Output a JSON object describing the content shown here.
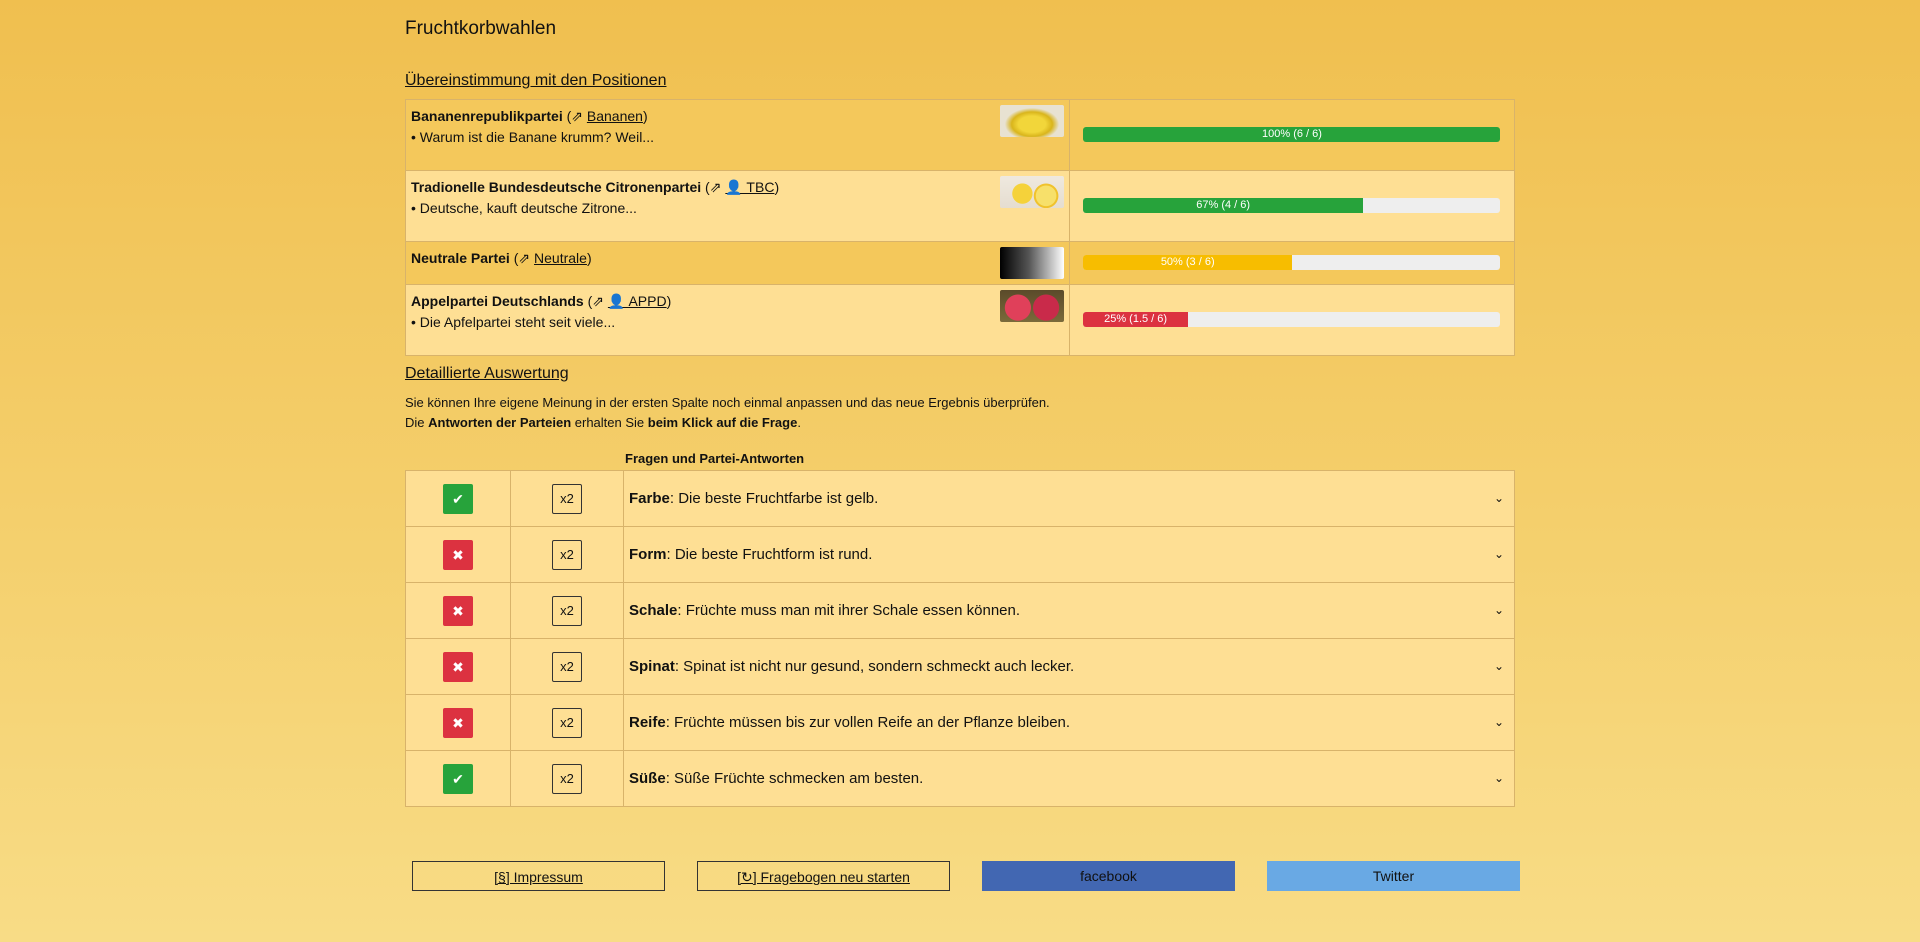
{
  "title": "Fruchtkorbwahlen",
  "sections": {
    "positions": "Übereinstimmung mit den Positionen",
    "details": "Detaillierte Auswertung"
  },
  "parties": [
    {
      "name": "Bananenrepublikpartei",
      "link": "Bananen",
      "desc": "• Warum ist die Banane krumm? Weil...",
      "bar_label": "100% (6 / 6)",
      "percent": 100,
      "color": "#27a33b",
      "icon": "banana-image"
    },
    {
      "name": "Tradionelle Bundesdeutsche Citronenpartei",
      "link": "👤 TBC",
      "desc": "• Deutsche, kauft deutsche Zitrone...",
      "bar_label": "67% (4 / 6)",
      "percent": 67,
      "color": "#27a33b",
      "icon": "lemon-image"
    },
    {
      "name": "Neutrale Partei",
      "link": "Neutrale",
      "desc": "",
      "bar_label": "50% (3 / 6)",
      "percent": 50,
      "color": "#f7bd00",
      "icon": "gradient-image"
    },
    {
      "name": "Appelpartei Deutschlands",
      "link": "👤 APPD",
      "desc": "• Die Apfelpartei steht seit viele...",
      "bar_label": "25% (1.5 / 6)",
      "percent": 25,
      "color": "#dc3240",
      "icon": "apple-image"
    }
  ],
  "description": {
    "line1": "Sie können Ihre eigene Meinung in der ersten Spalte noch einmal anpassen und das neue Ergebnis überprüfen.",
    "line2_pre": "Die ",
    "line2_b1": "Antworten der Parteien",
    "line2_mid": " erhalten Sie ",
    "line2_b2": "beim Klick auf die Frage",
    "line2_post": "."
  },
  "questions_header": "Fragen und Partei-Antworten",
  "questions": [
    {
      "topic": "Farbe",
      "text": ": Die beste Fruchtfarbe ist gelb.",
      "vote": "agree",
      "mult": "x2"
    },
    {
      "topic": "Form",
      "text": ": Die beste Fruchtform ist rund.",
      "vote": "disagree",
      "mult": "x2"
    },
    {
      "topic": "Schale",
      "text": ": Früchte muss man mit ihrer Schale essen können.",
      "vote": "disagree",
      "mult": "x2"
    },
    {
      "topic": "Spinat",
      "text": ": Spinat ist nicht nur gesund, sondern schmeckt auch lecker.",
      "vote": "disagree",
      "mult": "x2"
    },
    {
      "topic": "Reife",
      "text": ": Früchte müssen bis zur vollen Reife an der Pflanze bleiben.",
      "vote": "disagree",
      "mult": "x2"
    },
    {
      "topic": "Süße",
      "text": ": Süße Früchte schmecken am besten.",
      "vote": "agree",
      "mult": "x2"
    }
  ],
  "vote_symbols": {
    "agree": "✔",
    "disagree": "✖"
  },
  "footer": {
    "impressum": "[§] Impressum",
    "restart": "[↻] Fragebogen neu starten",
    "facebook": "facebook",
    "twitter": "Twitter"
  },
  "colors": {
    "agree": "#27a33b",
    "disagree": "#dc3240",
    "neutral": "#f7bd00",
    "facebook": "#4267b2",
    "twitter": "#69a9e4"
  }
}
